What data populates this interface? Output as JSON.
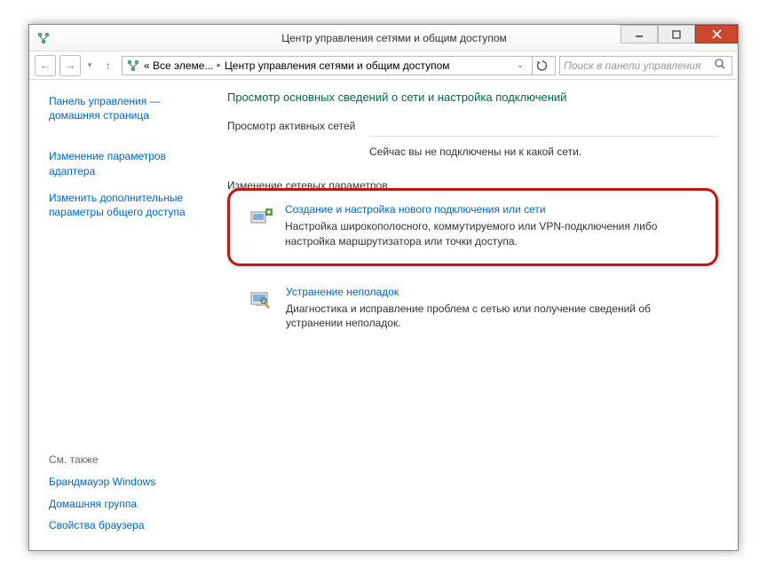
{
  "window": {
    "title": "Центр управления сетями и общим доступом"
  },
  "addressbar": {
    "segment1": "« Все элеме...",
    "segment2": "Центр управления сетями и общим доступом"
  },
  "search": {
    "placeholder": "Поиск в панели управления"
  },
  "sidebar": {
    "home": "Панель управления — домашняя страница",
    "adapter_settings": "Изменение параметров адаптера",
    "sharing_settings": "Изменить дополнительные параметры общего доступа",
    "see_also": "См. также",
    "firewall": "Брандмауэр Windows",
    "homegroup": "Домашняя группа",
    "browser_props": "Свойства браузера"
  },
  "main": {
    "heading": "Просмотр основных сведений о сети и настройка подключений",
    "active_networks_label": "Просмотр активных сетей",
    "no_connection": "Сейчас вы не подключены ни к какой сети.",
    "change_settings_label": "Изменение сетевых параметров",
    "task1": {
      "title": "Создание и настройка нового подключения или сети",
      "desc": "Настройка широкополосного, коммутируемого или VPN-подключения либо настройка маршрутизатора или точки доступа."
    },
    "task2": {
      "title": "Устранение неполадок",
      "desc": "Диагностика и исправление проблем с сетью или получение сведений об устранении неполадок."
    }
  }
}
